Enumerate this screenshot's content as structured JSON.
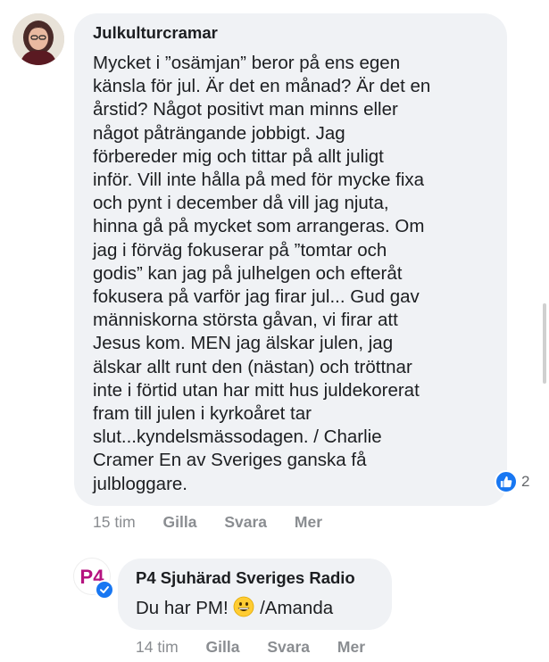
{
  "comments": [
    {
      "author": "Julkulturcramar",
      "text": "Mycket i ”osämjan” beror på ens egen\nkänsla för jul. Är det en månad? Är det en\nårstid? Något positivt man minns eller\nnågot påträngande jobbigt. Jag\nförbereder mig och tittar på allt juligt\ninför. Vill inte hålla på med för mycke fixa\noch pynt i december då vill jag njuta,\nhinna gå på mycket som arrangeras. Om\njag i förväg fokuserar på ”tomtar och\ngodis” kan jag på julhelgen och efteråt\nfokusera på varför jag firar jul... Gud gav\nmänniskorna största gåvan, vi firar att\nJesus kom. MEN jag älskar julen, jag\nälskar allt runt den (nästan) och tröttnar\ninte i förtid utan har mitt hus juldekorerat\nfram till julen i kyrkoåret tar\nslut...kyndelsmässodagen. / Charlie\nCramer En av Sveriges ganska få\njulbloggare.",
      "reaction_count": "2",
      "time": "15 tim",
      "like_label": "Gilla",
      "reply_label": "Svara",
      "more_label": "Mer"
    },
    {
      "author": "P4 Sjuhärad Sveriges Radio",
      "text_before_emoji": "Du har PM! ",
      "text_after_emoji": " /Amanda",
      "avatar_text": "P4",
      "time": "14 tim",
      "like_label": "Gilla",
      "reply_label": "Svara",
      "more_label": "Mer"
    }
  ],
  "colors": {
    "bubble": "#f0f2f5",
    "like_blue": "#1877f2",
    "meta_gray": "#8a8d91",
    "p4_magenta": "#b5127f"
  },
  "icons": [
    "thumbs-up-icon",
    "verified-badge-icon",
    "grinning-emoji-icon"
  ]
}
